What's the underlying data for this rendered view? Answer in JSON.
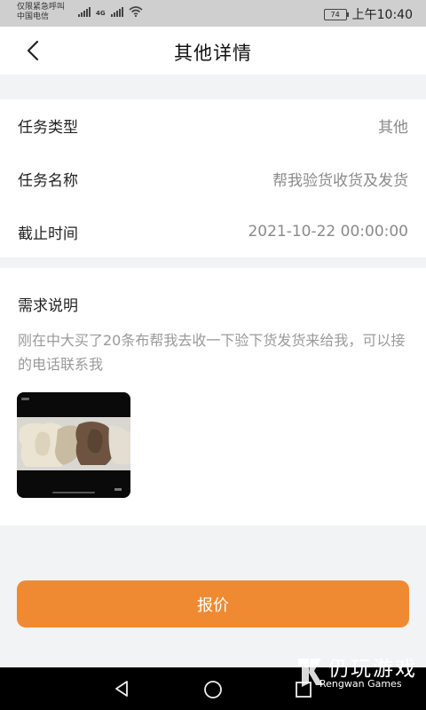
{
  "status": {
    "notice": "仅限紧急呼叫",
    "carrier": "中国电信",
    "network": "4G",
    "battery": "74",
    "time": "上午10:40"
  },
  "nav": {
    "title": "其他详情",
    "back_icon": "chevron-left-icon"
  },
  "details": [
    {
      "label": "任务类型",
      "value": "其他"
    },
    {
      "label": "任务名称",
      "value": "帮我验货收货及发货"
    },
    {
      "label": "截止时间",
      "value": "2021-10-22 00:00:00"
    }
  ],
  "requirement": {
    "title": "需求说明",
    "text": "刚在中大买了20条布帮我去收一下验下货发货来给我，可以接的电话联系我"
  },
  "action": {
    "quote_label": "报价",
    "color": "#f08a32"
  },
  "watermark": {
    "main": "仍玩游戏",
    "sub": "Rengwan Games"
  }
}
